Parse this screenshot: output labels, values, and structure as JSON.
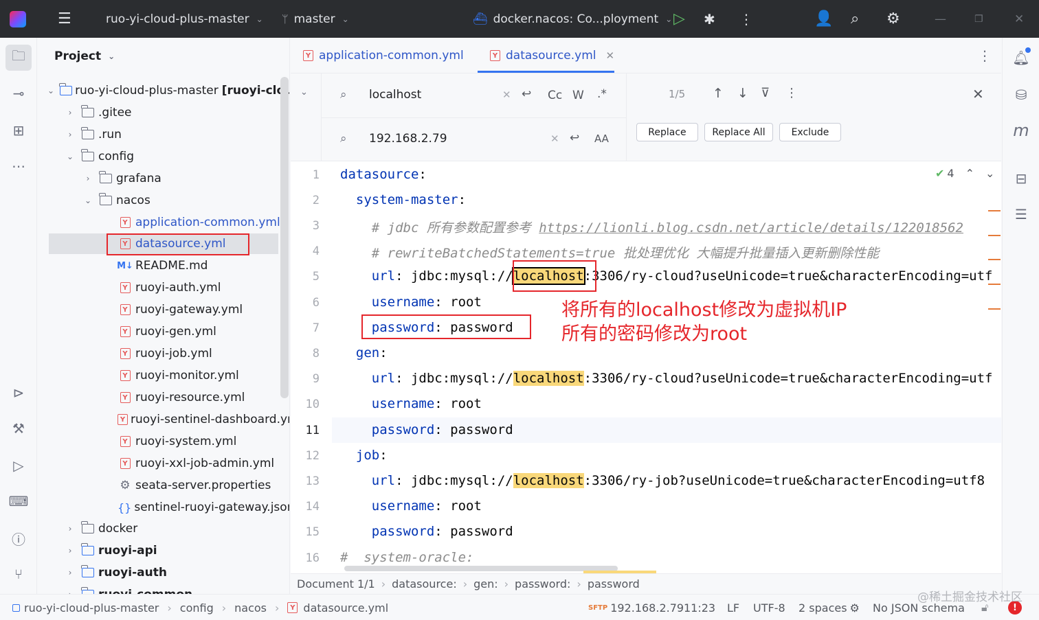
{
  "titlebar": {
    "project": "ruo-yi-cloud-plus-master",
    "branch": "master",
    "run_config": "docker.nacos: Co...ployment"
  },
  "project_panel": {
    "title": "Project",
    "root": "ruo-yi-cloud-plus-master",
    "root_module": "[ruoyi-cloud-",
    "items": [
      {
        "label": ".gitee"
      },
      {
        "label": ".run"
      },
      {
        "label": "config"
      },
      {
        "label": "grafana"
      },
      {
        "label": "nacos"
      },
      {
        "label": "application-common.yml"
      },
      {
        "label": "datasource.yml"
      },
      {
        "label": "README.md"
      },
      {
        "label": "ruoyi-auth.yml"
      },
      {
        "label": "ruoyi-gateway.yml"
      },
      {
        "label": "ruoyi-gen.yml"
      },
      {
        "label": "ruoyi-job.yml"
      },
      {
        "label": "ruoyi-monitor.yml"
      },
      {
        "label": "ruoyi-resource.yml"
      },
      {
        "label": "ruoyi-sentinel-dashboard.yml"
      },
      {
        "label": "ruoyi-system.yml"
      },
      {
        "label": "ruoyi-xxl-job-admin.yml"
      },
      {
        "label": "seata-server.properties"
      },
      {
        "label": "sentinel-ruoyi-gateway.json"
      },
      {
        "label": "docker"
      },
      {
        "label": "ruoyi-api"
      },
      {
        "label": "ruoyi-auth"
      },
      {
        "label": "ruoyi-common"
      }
    ]
  },
  "tabs": [
    {
      "label": "application-common.yml"
    },
    {
      "label": "datasource.yml"
    }
  ],
  "find": {
    "search_value": "localhost",
    "replace_value": "192.168.2.79",
    "match_count": "1/5",
    "case_label": "Cc",
    "word_label": "W",
    "regex_label": ".*",
    "preserve_case_label": "AA",
    "replace_label": "Replace",
    "replace_all_label": "Replace All",
    "exclude_label": "Exclude"
  },
  "inspections": {
    "count": "4"
  },
  "code": {
    "line_numbers": [
      "1",
      "2",
      "3",
      "4",
      "5",
      "6",
      "7",
      "8",
      "9",
      "10",
      "11",
      "12",
      "13",
      "14",
      "15",
      "16"
    ],
    "l1_key": "datasource",
    "l2_key": "system-master",
    "l3_comment": "# jdbc 所有参数配置参考 ",
    "l3_link": "https://lionli.blog.csdn.net/article/details/122018562",
    "l4_comment": "# rewriteBatchedStatements=true 批处理优化 大幅提升批量插入更新删除性能",
    "url_key": "url",
    "url_prefix": "jdbc:mysql://",
    "host": "localhost",
    "l5_rest": ":3306/ry-cloud?useUnicode=true&characterEncoding=utf",
    "username_key": "username",
    "username_val": "root",
    "password_key": "password",
    "password_val": "password",
    "l8_key": "gen",
    "l9_rest": ":3306/ry-cloud?useUnicode=true&characterEncoding=utf",
    "l12_key": "job",
    "l13_rest": ":3306/ry-job?useUnicode=true&characterEncoding=utf8",
    "l16_comment": "#  system-oracle:"
  },
  "annotation": {
    "line1": "将所有的localhost修改为虚拟机IP",
    "line2": "所有的密码修改为root"
  },
  "editor_breadcrumbs": [
    "Document 1/1",
    "datasource:",
    "gen:",
    "password:",
    "password"
  ],
  "status": {
    "path": [
      "ruo-yi-cloud-plus-master",
      "config",
      "nacos",
      "datasource.yml"
    ],
    "sftp_host": "192.168.2.79",
    "position": "11:23",
    "line_sep": "LF",
    "encoding": "UTF-8",
    "indent": "2 spaces",
    "schema": "No JSON schema"
  },
  "watermark": "@稀土掘金技术社区",
  "colors": {
    "accent": "#3574f0",
    "annotation_red": "#e5262b",
    "highlight": "#f9d87a"
  }
}
